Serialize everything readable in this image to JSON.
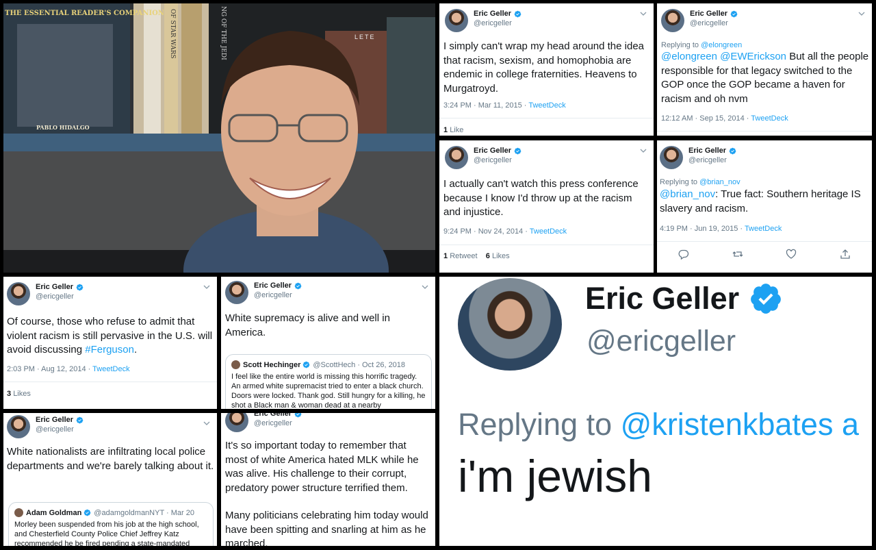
{
  "colors": {
    "link": "#1da1f2",
    "verified": "#1da1f2",
    "muted": "#657786",
    "text": "#14171a",
    "border": "#ccd6dd"
  },
  "photo": {
    "book_title": "THE ESSENTIAL READER'S COMPANION",
    "book_author": "PABLO HIDALGO",
    "spine_1": "OF STAR WARS",
    "spine_2": "NG OF THE JEDI",
    "spine_3": "LETE"
  },
  "tweets": [
    {
      "name": "Eric Geller",
      "handle": "@ericgeller",
      "text": "I simply can't wrap my head around the idea that racism, sexism, and homophobia are endemic in college fraternities. Heavens to Murgatroyd.",
      "time": "3:24 PM · Mar 11, 2015 · ",
      "source": "TweetDeck",
      "likes_count": "1",
      "likes_label": "Like"
    },
    {
      "name": "Eric Geller",
      "handle": "@ericgeller",
      "reply_prefix": "Replying to ",
      "reply_to": "@elongreen",
      "mentions": "@elongreen @EWErickson",
      "text": " But all the people responsible for that legacy switched to the GOP once the GOP became a haven for racism and oh nvm",
      "time": "12:12 AM · Sep 15, 2014 · ",
      "source": "TweetDeck"
    },
    {
      "name": "Eric Geller",
      "handle": "@ericgeller",
      "text": "I actually can't watch this press conference because I know I'd throw up at the racism and injustice.",
      "time": "9:24 PM · Nov 24, 2014 · ",
      "source": "TweetDeck",
      "retweets_count": "1",
      "retweets_label": "Retweet",
      "likes_count": "6",
      "likes_label": "Likes"
    },
    {
      "name": "Eric Geller",
      "handle": "@ericgeller",
      "reply_prefix": "Replying to ",
      "reply_to": "@brian_nov",
      "mention": "@brian_nov",
      "text": ": True fact: Southern heritage IS slavery and racism.",
      "time": "4:19 PM · Jun 19, 2015 · ",
      "source": "TweetDeck"
    },
    {
      "name": "Eric Geller",
      "handle": "@ericgeller",
      "text": "Of course, those who refuse to admit that violent racism is still pervasive in the U.S. will avoid discussing ",
      "hashtag": "#Ferguson",
      "text_end": ".",
      "time": "2:03 PM · Aug 12, 2014 · ",
      "source": "TweetDeck",
      "likes_count": "3",
      "likes_label": "Likes"
    },
    {
      "name": "Eric Geller",
      "handle": "@ericgeller",
      "text": "White supremacy is alive and well in America.",
      "quote": {
        "name": "Scott Hechinger",
        "handle": "@ScottHech · Oct 26, 2018",
        "text": "I feel like the entire world is missing this horrific tragedy. An armed white supremacist tried to enter a black church. Doors were locked. Thank god. Still hungry for a killing, he shot a Black man & woman dead at a nearby supermarket."
      }
    },
    {
      "name": "Eric Geller",
      "handle": "@ericgeller",
      "text": "White nationalists are infiltrating local police departments and we're barely talking about it.",
      "quote": {
        "name": "Adam Goldman",
        "handle": "@adamgoldmanNYT · Mar 20",
        "text": "Morley been suspended from his job at the high school, and Chesterfield County Police Chief Jeffrey Katz recommended he be fired pending a state-mandated"
      }
    },
    {
      "name": "Eric Geller",
      "handle": "@ericgeller",
      "text": "It's so important today to remember that most of white America hated MLK while he was alive. His challenge to their corrupt, predatory power structure terrified them.",
      "text2": "Many politicians celebrating him today would have been spitting and snarling at him as he marched."
    }
  ],
  "zoom": {
    "name": "Eric Geller",
    "handle": "@ericgeller",
    "reply_prefix": "Replying to ",
    "reply_to": "@kristenkbates a",
    "text": "i'm jewish"
  }
}
